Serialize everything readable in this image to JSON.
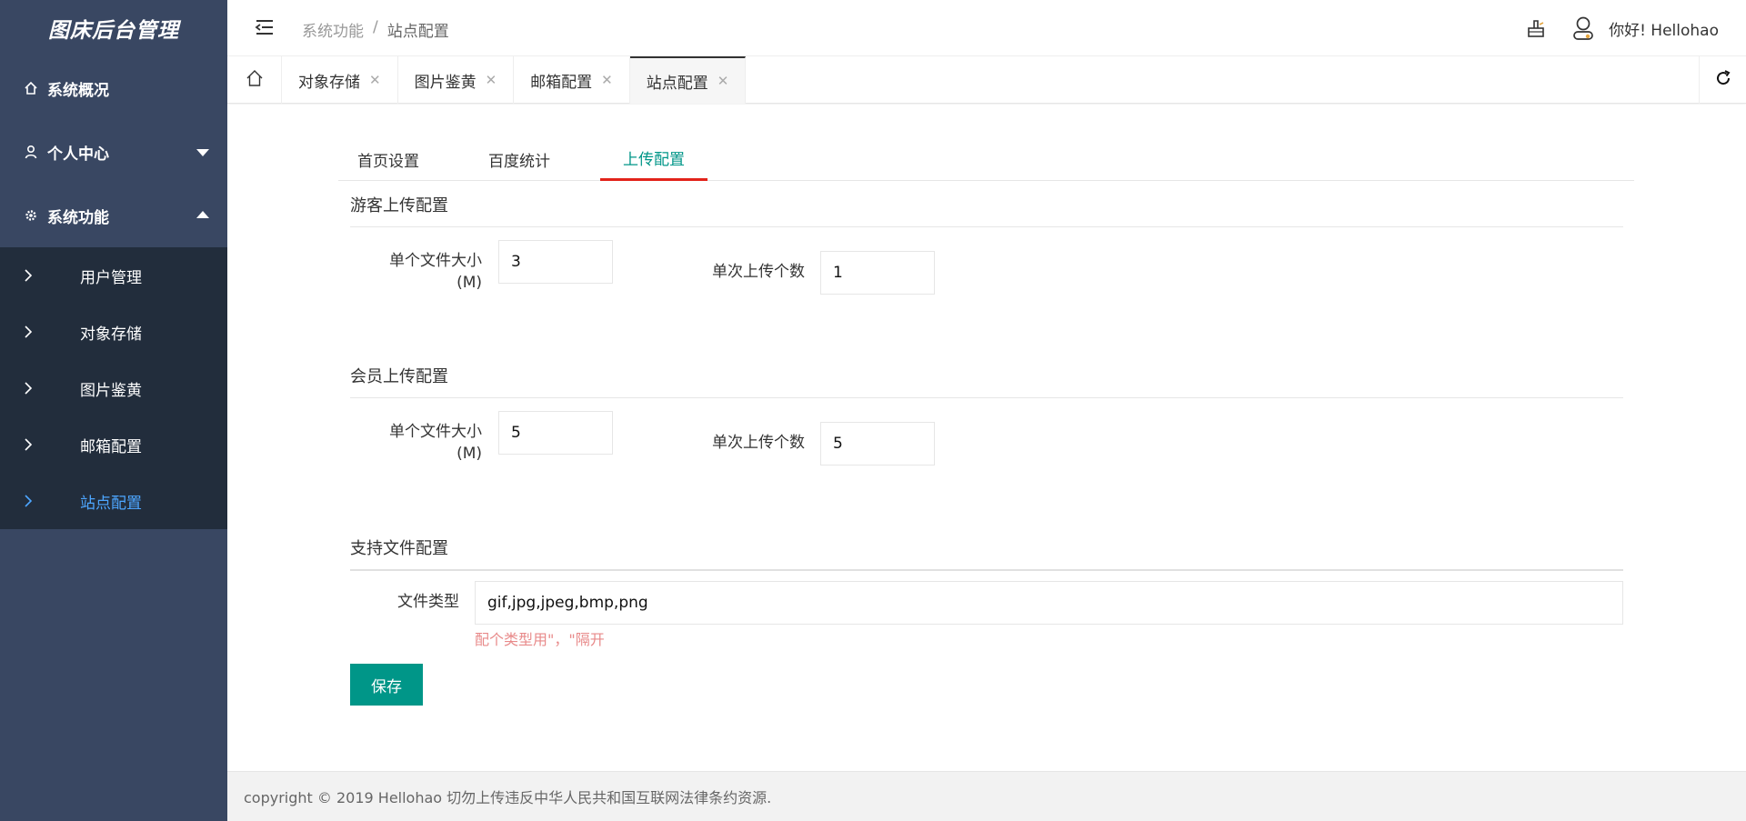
{
  "app": {
    "title": "图床后台管理"
  },
  "sidebar": {
    "menus": [
      {
        "label": "系统概况",
        "icon": "home-icon"
      },
      {
        "label": "个人中心",
        "icon": "user-icon"
      },
      {
        "label": "系统功能",
        "icon": "gear-icon"
      }
    ],
    "sub_items": [
      {
        "label": "用户管理"
      },
      {
        "label": "对象存储"
      },
      {
        "label": "图片鉴黄"
      },
      {
        "label": "邮箱配置"
      },
      {
        "label": "站点配置",
        "active": true
      }
    ]
  },
  "header": {
    "breadcrumb": [
      "系统功能",
      "/",
      "站点配置"
    ],
    "greeting": "你好!  Hellohao"
  },
  "tabs": {
    "items": [
      {
        "label": "对象存储"
      },
      {
        "label": "图片鉴黄"
      },
      {
        "label": "邮箱配置"
      },
      {
        "label": "站点配置",
        "active": true
      }
    ],
    "close_glyph": "✕"
  },
  "subtabs": [
    {
      "label": "首页设置"
    },
    {
      "label": "百度统计"
    },
    {
      "label": "上传配置",
      "active": true
    }
  ],
  "guest": {
    "title": "游客上传配置",
    "size_label_1": "单个文件大小",
    "size_label_2": "(M)",
    "size_value": "3",
    "count_label": "单次上传个数",
    "count_value": "1"
  },
  "member": {
    "title": "会员上传配置",
    "size_label_1": "单个文件大小",
    "size_label_2": "(M)",
    "size_value": "5",
    "count_label": "单次上传个数",
    "count_value": "5"
  },
  "filetypes": {
    "title": "支持文件配置",
    "label": "文件类型",
    "value": "gif,jpg,jpeg,bmp,png",
    "hint": "配个类型用\"，\"隔开"
  },
  "save_label": "保存",
  "footer": {
    "text": "copyright © 2019 Hellohao 切勿上传违反中华人民共和国互联网法律条约资源."
  },
  "colors": {
    "sidebar": "#394762",
    "submenu": "#222d3c",
    "accent": "#009688",
    "tab_underline": "#e2231a",
    "active_link": "#4da6ff"
  }
}
